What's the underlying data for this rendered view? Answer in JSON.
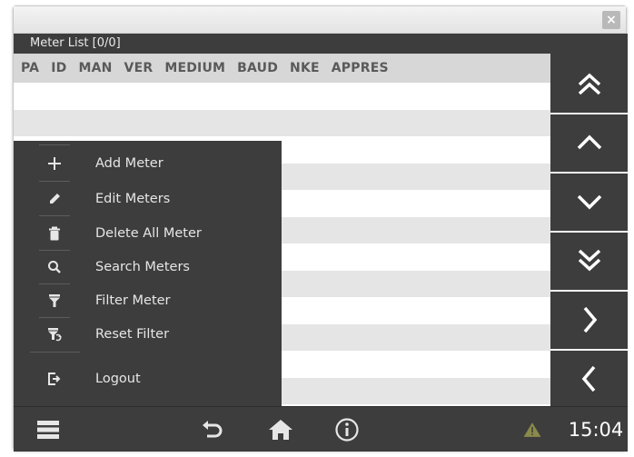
{
  "window": {
    "close_glyph": "×"
  },
  "header": {
    "title": "Meter List [0/0]"
  },
  "table": {
    "columns": [
      "PA",
      "ID",
      "MAN",
      "VER",
      "MEDIUM",
      "BAUD",
      "NKE",
      "APPRES"
    ],
    "row_count": 13
  },
  "nav": [
    {
      "name": "scroll-first-button",
      "icon": "double-chevron-up-icon"
    },
    {
      "name": "scroll-up-button",
      "icon": "chevron-up-icon"
    },
    {
      "name": "scroll-down-button",
      "icon": "chevron-down-icon"
    },
    {
      "name": "scroll-last-button",
      "icon": "double-chevron-down-icon"
    },
    {
      "name": "next-button",
      "icon": "chevron-right-icon"
    },
    {
      "name": "back-button",
      "icon": "chevron-left-icon"
    }
  ],
  "menu": {
    "items": [
      {
        "label": "Add Meter",
        "icon": "plus-icon"
      },
      {
        "label": "Edit Meters",
        "icon": "pencil-icon"
      },
      {
        "label": "Delete All Meter",
        "icon": "trash-icon"
      },
      {
        "label": "Search Meters",
        "icon": "search-icon"
      },
      {
        "label": "Filter Meter",
        "icon": "filter-icon"
      },
      {
        "label": "Reset Filter",
        "icon": "reset-filter-icon"
      },
      {
        "label": "Logout",
        "icon": "logout-icon"
      }
    ]
  },
  "bottom_bar": {
    "menu_icon": "menu-list-icon",
    "undo_icon": "undo-icon",
    "home_icon": "home-icon",
    "info_icon": "info-icon",
    "warning_icon": "warning-icon",
    "clock": "15:04"
  },
  "colors": {
    "dark_bar": "#3d3d3d",
    "row_alt": "#e5e5e5",
    "header_row": "#d7d7d7",
    "warning": "#8a8a4a"
  }
}
